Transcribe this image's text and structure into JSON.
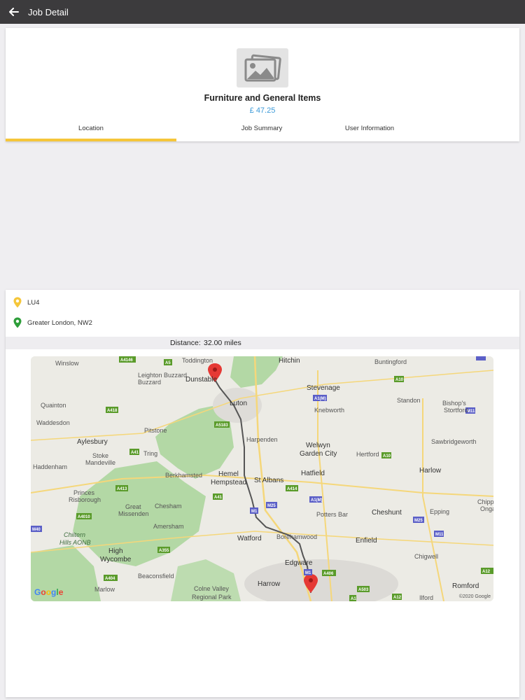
{
  "header": {
    "title": "Job Detail",
    "back_icon": "arrow-left-icon"
  },
  "job": {
    "image_icon": "image-placeholder-icon",
    "title": "Furniture and General Items",
    "price": "£ 47.25"
  },
  "tabs": [
    {
      "label": "Location",
      "active": true
    },
    {
      "label": "Job Summary",
      "active": false
    },
    {
      "label": "User Information",
      "active": false
    }
  ],
  "colors": {
    "accent": "#f5c63a",
    "price": "#3c9ad8",
    "pickup_pin": "#f5c63a",
    "dropoff_pin": "#2e9e3a",
    "route": "#555555",
    "map_marker": "#e53935"
  },
  "locations": {
    "pickup": {
      "icon": "map-pin-yellow-icon",
      "text": "LU4"
    },
    "dropoff": {
      "icon": "map-pin-green-icon",
      "text": "Greater London, NW2"
    }
  },
  "distance": {
    "label": "Distance:",
    "value": "32.00 miles"
  },
  "map": {
    "places": [
      "Winslow",
      "Toddington",
      "Hitchin",
      "Buntingford",
      "Leighton Buzzard",
      "Dunstable",
      "Luton",
      "Stevenage",
      "Standon",
      "Bishop's Stortford",
      "Quainton",
      "Knebworth",
      "Waddesdon",
      "Pitstone",
      "Aylesbury",
      "Harpenden",
      "Welwyn Garden City",
      "Hertford",
      "Sawbridgeworth",
      "Stoke Mandeville",
      "Tring",
      "Haddenham",
      "Berkhamsted",
      "Hemel Hempstead",
      "St Albans",
      "Hatfield",
      "Harlow",
      "Princes Risborough",
      "Great Missenden",
      "Chesham",
      "Potters Bar",
      "Cheshunt",
      "Epping",
      "Chipping Ongar",
      "Chiltern Hills AONB",
      "Amersham",
      "Watford",
      "Borehamwood",
      "Enfield",
      "High Wycombe",
      "Chigwell",
      "Beaconsfield",
      "Edgware",
      "Harrow",
      "Marlow",
      "Colne Valley Regional Park",
      "Romford",
      "Ilford"
    ],
    "google_logo": "Google",
    "copyright": "©2020 Google"
  }
}
